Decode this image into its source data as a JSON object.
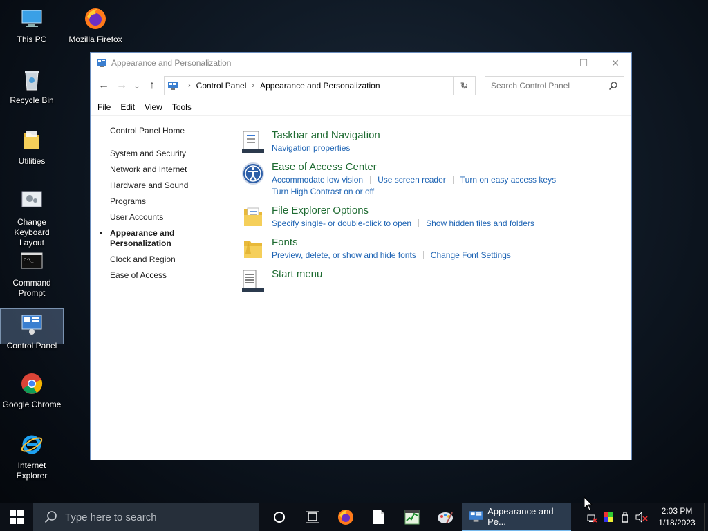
{
  "desktop": {
    "icons": [
      {
        "label": "This PC"
      },
      {
        "label": "Mozilla Firefox"
      },
      {
        "label": "Recycle Bin"
      },
      {
        "label": "Utilities"
      },
      {
        "label": "Change Keyboard Layout"
      },
      {
        "label": "Command Prompt"
      },
      {
        "label": "Control Panel"
      },
      {
        "label": "Google Chrome"
      },
      {
        "label": "Internet Explorer"
      }
    ]
  },
  "window": {
    "title": "Appearance and Personalization",
    "controls": {
      "minimize": "—",
      "maximize": "☐",
      "close": "✕"
    },
    "nav": {
      "back": "←",
      "forward": "→",
      "recent": "⌄",
      "up": "↑",
      "refresh": "↻"
    },
    "breadcrumb": [
      "Control Panel",
      "Appearance and Personalization"
    ],
    "search_placeholder": "Search Control Panel",
    "menu": [
      "File",
      "Edit",
      "View",
      "Tools"
    ],
    "left_nav": {
      "home": "Control Panel Home",
      "items": [
        "System and Security",
        "Network and Internet",
        "Hardware and Sound",
        "Programs",
        "User Accounts",
        "Appearance and Personalization",
        "Clock and Region",
        "Ease of Access"
      ],
      "current_index": 5
    },
    "categories": [
      {
        "title": "Taskbar and Navigation",
        "icon": "taskbar-icon",
        "links": [
          "Navigation properties"
        ]
      },
      {
        "title": "Ease of Access Center",
        "icon": "ease-of-access-icon",
        "links": [
          "Accommodate low vision",
          "Use screen reader",
          "Turn on easy access keys",
          "Turn High Contrast on or off"
        ]
      },
      {
        "title": "File Explorer Options",
        "icon": "folder-options-icon",
        "links": [
          "Specify single- or double-click to open",
          "Show hidden files and folders"
        ]
      },
      {
        "title": "Fonts",
        "icon": "fonts-folder-icon",
        "links": [
          "Preview, delete, or show and hide fonts",
          "Change Font Settings"
        ]
      },
      {
        "title": "Start menu",
        "icon": "start-menu-icon",
        "links": []
      }
    ]
  },
  "taskbar": {
    "search_placeholder": "Type here to search",
    "active_app": "Appearance and Pe...",
    "time": "2:03 PM",
    "date": "1/18/2023"
  },
  "colors": {
    "category_title": "#1e6b31",
    "link": "#1e64b4",
    "taskbar": "#0c1017"
  }
}
